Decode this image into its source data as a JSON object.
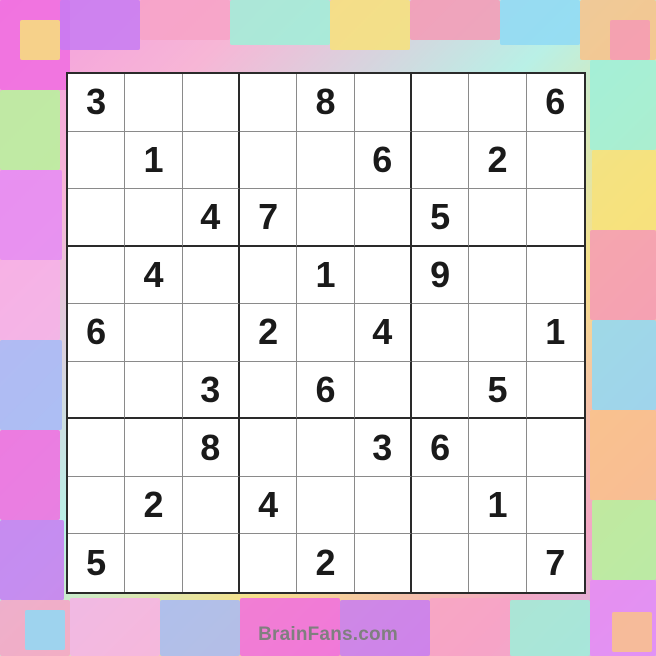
{
  "puzzle": {
    "grid": [
      [
        "3",
        "",
        "",
        "",
        "8",
        "",
        "",
        "",
        "6"
      ],
      [
        "",
        "1",
        "",
        "",
        "",
        "6",
        "",
        "2",
        ""
      ],
      [
        "",
        "",
        "4",
        "7",
        "",
        "",
        "5",
        "",
        ""
      ],
      [
        "",
        "4",
        "",
        "",
        "1",
        "",
        "9",
        "",
        ""
      ],
      [
        "6",
        "",
        "",
        "2",
        "",
        "4",
        "",
        "",
        "1"
      ],
      [
        "",
        "",
        "3",
        "",
        "6",
        "",
        "",
        "5",
        ""
      ],
      [
        "",
        "",
        "8",
        "",
        "",
        "3",
        "6",
        "",
        ""
      ],
      [
        "",
        "2",
        "",
        "4",
        "",
        "",
        "",
        "1",
        ""
      ],
      [
        "5",
        "",
        "",
        "",
        "2",
        "",
        "",
        "",
        "7"
      ]
    ]
  },
  "footer": {
    "brand": "BrainFans.com"
  },
  "colors": {
    "cell_background": "#ffffff",
    "digit": "#1a1a1a",
    "thick_line": "#2a2a2a",
    "thin_line": "#8a8a8a",
    "watermark": "#7f7f7f"
  }
}
